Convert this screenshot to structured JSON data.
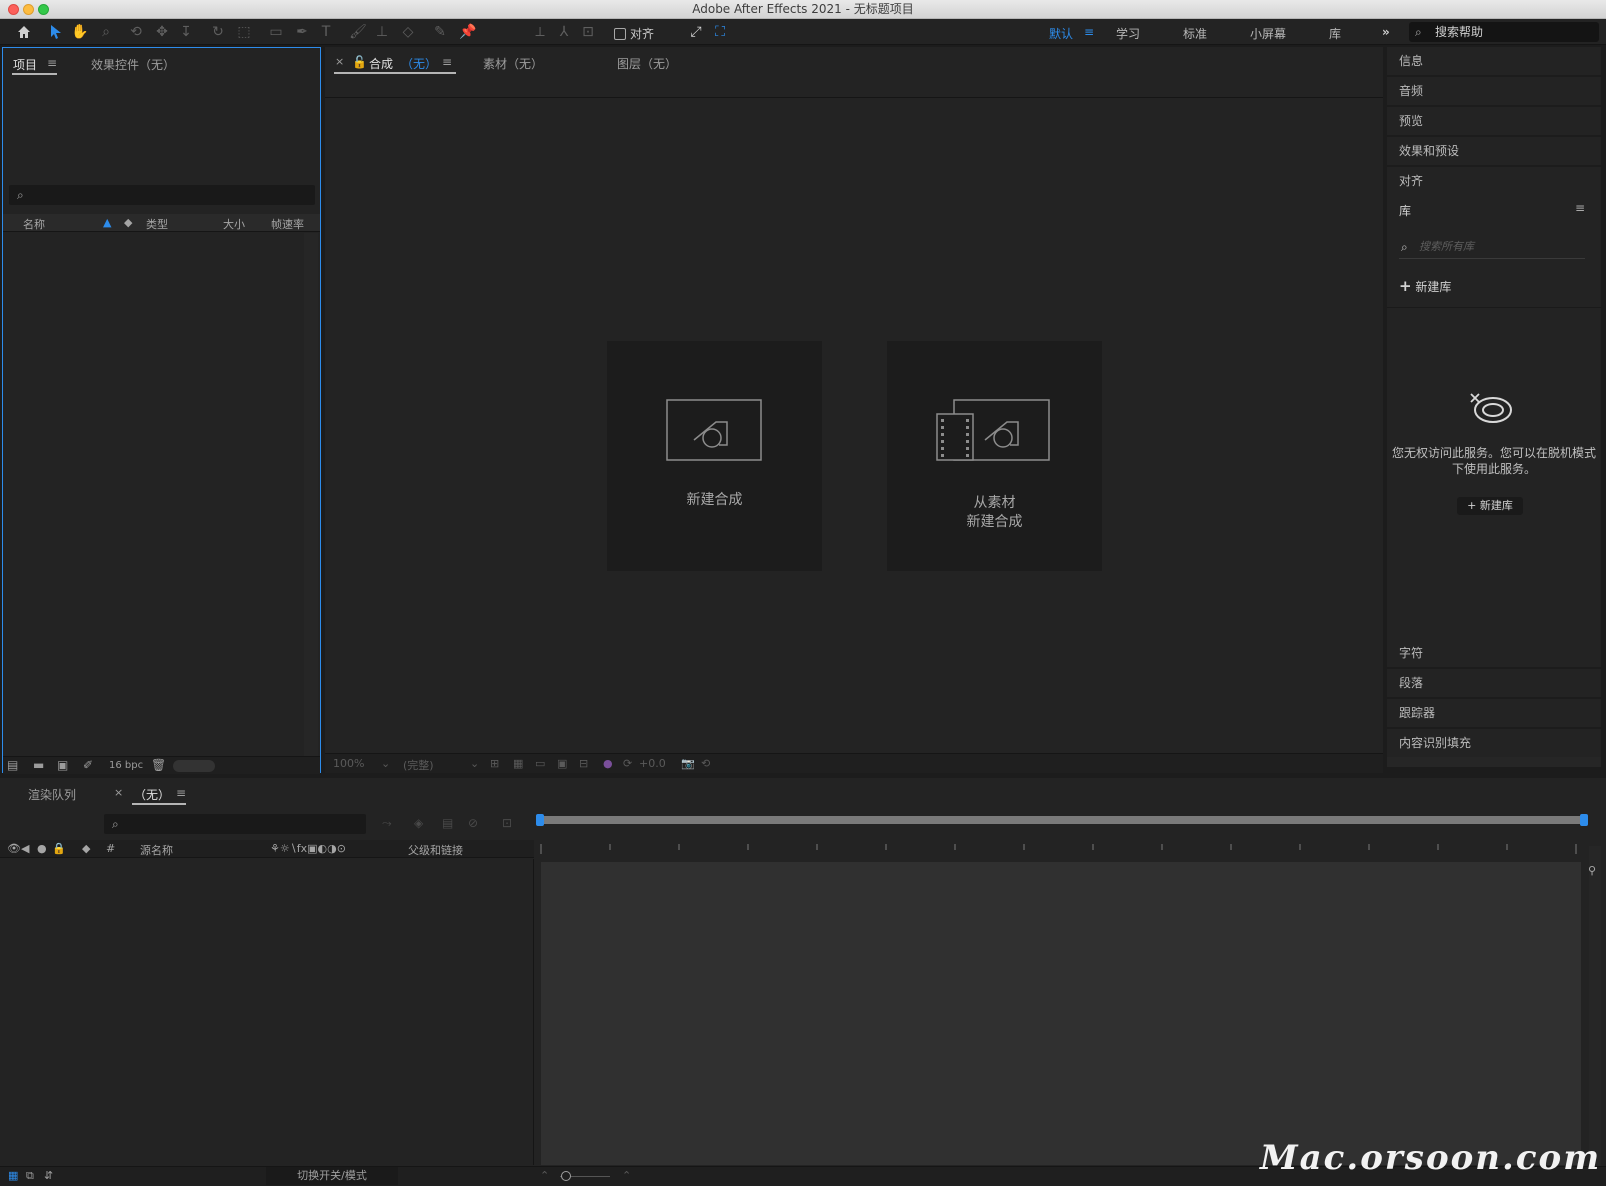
{
  "window": {
    "title": "Adobe After Effects 2021 - 无标题项目"
  },
  "toolbar": {
    "snap_label": "对齐",
    "workspaces": [
      "默认",
      "学习",
      "标准",
      "小屏幕",
      "库"
    ],
    "active_workspace": "默认",
    "overflow": "»",
    "search_help": "搜索帮助"
  },
  "project": {
    "tabs": [
      "项目",
      "效果控件（无）"
    ],
    "search_icon": "⌕",
    "columns": {
      "name": "名称",
      "type": "类型",
      "size": "大小",
      "fps": "帧速率"
    },
    "bpc": "16 bpc"
  },
  "comp": {
    "tab_comp": "合成",
    "tab_comp_state": "（无）",
    "tab_footage": "素材（无）",
    "tab_layer": "图层（无）",
    "cards": [
      {
        "label": "新建合成"
      },
      {
        "label_line1": "从素材",
        "label_line2": "新建合成"
      }
    ],
    "footer": {
      "zoom": "100%",
      "quality": "(完整)",
      "exposure": "+0.0"
    }
  },
  "right": {
    "items_top": [
      "信息",
      "音频",
      "预览",
      "效果和预设",
      "对齐"
    ],
    "library": {
      "title": "库",
      "search_placeholder": "搜索所有库",
      "new_lib": "新建库",
      "message": "您无权访问此服务。您可以在脱机模式下使用此服务。",
      "new_button": "+ 新建库"
    },
    "items_bottom": [
      "字符",
      "段落",
      "跟踪器",
      "内容识别填充"
    ]
  },
  "timeline": {
    "tabs": [
      "渲染队列",
      "（无）"
    ],
    "columns": {
      "hash": "#",
      "source": "源名称",
      "parent": "父级和链接"
    },
    "footer_toggle": "切换开关/模式"
  },
  "watermark": "Mac.orsoon.com",
  "colors": {
    "accent": "#2d8ceb",
    "panel": "#232323",
    "background": "#1c1c1c"
  }
}
